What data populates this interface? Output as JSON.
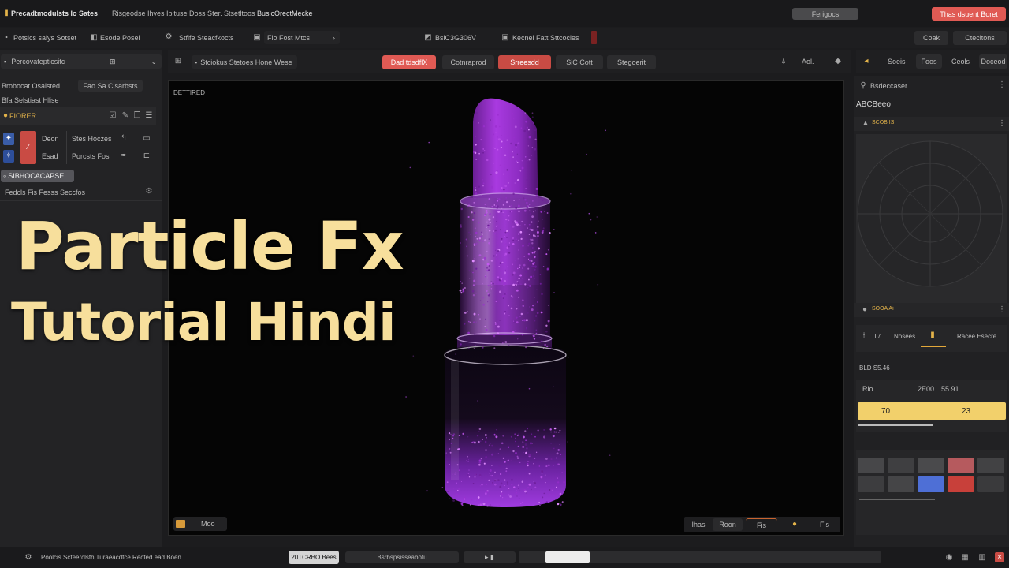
{
  "titlebar": {
    "app_title": "Precadtmodulsts lo Sates",
    "menu_a": "Risgeodse Ihves Ibltuse Doss Ster.",
    "menu_b": "Stsetltoos",
    "menu_c": "BusicOrectMecke",
    "mid_button": "Ferigocs",
    "right_button": "Thas dsuent Boret"
  },
  "toolbar": {
    "item1": "Potsics salys Sotset",
    "item2": "Esode Posel",
    "item3": "Stfife Steacfkocts",
    "item4": "Flo Fost Mtcs",
    "item5": "BslC3G306V",
    "item6": "Kecnel Fatt Sttcocles",
    "right1": "Coak",
    "right2": "Ctecltons"
  },
  "left_panel": {
    "dropdown": "Percovatepticsitc",
    "row_a_label": "Brobocat Osaisted",
    "row_a_btn": "Fao Sa Clsarbsts",
    "row_b_label": "Bfa Selstiast Hlise",
    "section_label": "FIORER",
    "tool_a": "Deon",
    "tool_b": "Esad",
    "tool_c": "Stes Hoczes",
    "tool_d": "Porcsts Fos",
    "highlight": "SIBHOCACAPSE",
    "footer": "Fedcls Fis Fesss Seccfos"
  },
  "overlay": {
    "line1": "Particle Fx",
    "line2": "Tutorial Hindi"
  },
  "viewport_toolbar": {
    "label": "Stciokus Stetoes Hone Wese",
    "tab1": "Dad tdsdflX",
    "tab2": "Cotnraprod",
    "tab3": "Srreesdd",
    "tab4": "SiC Cott",
    "tab5": "Stegoerit",
    "right1": "Aol.",
    "right2": "Soeis",
    "right3": "Foos",
    "right4": "Ceols",
    "right5": "Doceod"
  },
  "viewport": {
    "corner_label": "DETTIRED",
    "bottom_left": "Moo",
    "bottom_btn1": "Ihas",
    "bottom_btn2": "Roon",
    "bottom_btn3": "Fis",
    "bottom_btn4": "Fis"
  },
  "right_panel": {
    "header": "Bsdeccaser",
    "sub": "ABCBeeo",
    "section1": "SCOB IS",
    "section2": "SOOA Ai",
    "slider_label_a": "T7",
    "slider_label_b": "Nosees",
    "slider_label_c": "Racee Esecre",
    "section3": "BLD S5.46",
    "val_a": "Rio",
    "val_b": "2E00",
    "val_c": "55.91",
    "bar_left": "70",
    "bar_right": "23"
  },
  "statusbar": {
    "left_text": "Poolcis Scteerclsfh Turaeacdfce Recfed ead Boen",
    "active": "20TCRBO Bees",
    "item2": "Bsrbspsisseabotu"
  },
  "colors": {
    "accent_red": "#e05a54",
    "accent_yellow": "#f2d06b",
    "overlay_text": "#f7df9c",
    "particle_purple": "#9b2fcf"
  }
}
